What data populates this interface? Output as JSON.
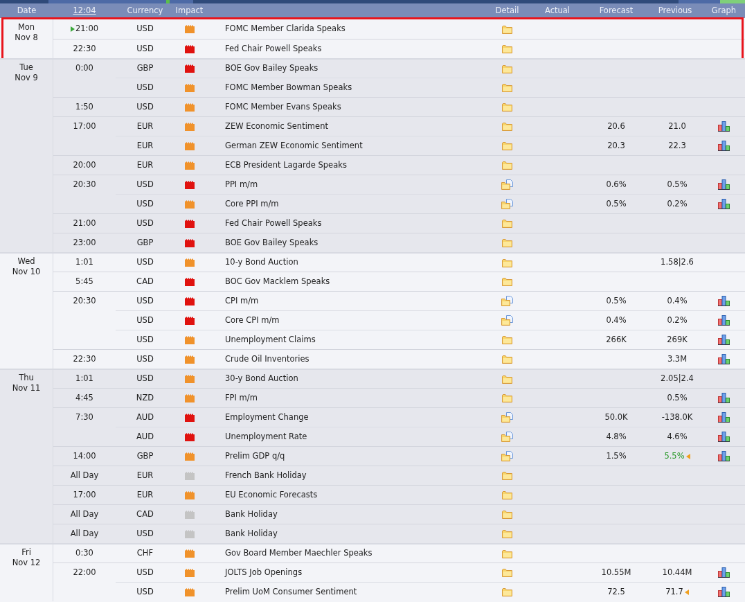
{
  "header": {
    "columns": [
      {
        "label": "Date",
        "link": false
      },
      {
        "label": "12:04",
        "link": true
      },
      {
        "label": "Currency",
        "link": false
      },
      {
        "label": "Impact",
        "link": false
      },
      {
        "label": "Detail",
        "link": false
      },
      {
        "label": "Actual",
        "link": false
      },
      {
        "label": "Forecast",
        "link": false
      },
      {
        "label": "Previous",
        "link": false
      },
      {
        "label": "Graph",
        "link": false
      }
    ]
  },
  "days": [
    {
      "weekday": "Mon",
      "date": "Nov 8",
      "highlighted": true,
      "slots": [
        {
          "time": "21:00",
          "upcoming": true,
          "events": [
            {
              "currency": "USD",
              "impact": {
                "kind": "medium"
              },
              "title": "FOMC Member Clarida Speaks",
              "detail": {
                "kind": "folder"
              },
              "graph": false
            }
          ]
        },
        {
          "time": "22:30",
          "upcoming": false,
          "events": [
            {
              "currency": "USD",
              "impact": {
                "kind": "high"
              },
              "title": "Fed Chair Powell Speaks",
              "detail": {
                "kind": "folder"
              },
              "graph": false
            }
          ]
        }
      ]
    },
    {
      "weekday": "Tue",
      "date": "Nov 9",
      "highlighted": false,
      "slots": [
        {
          "time": "0:00",
          "upcoming": false,
          "events": [
            {
              "currency": "GBP",
              "impact": {
                "kind": "high"
              },
              "title": "BOE Gov Bailey Speaks",
              "detail": {
                "kind": "folder"
              },
              "graph": false
            },
            {
              "currency": "USD",
              "impact": {
                "kind": "medium"
              },
              "title": "FOMC Member Bowman Speaks",
              "detail": {
                "kind": "folder"
              },
              "graph": false
            }
          ]
        },
        {
          "time": "1:50",
          "upcoming": false,
          "events": [
            {
              "currency": "USD",
              "impact": {
                "kind": "medium"
              },
              "title": "FOMC Member Evans Speaks",
              "detail": {
                "kind": "folder"
              },
              "graph": false
            }
          ]
        },
        {
          "time": "17:00",
          "upcoming": false,
          "events": [
            {
              "currency": "EUR",
              "impact": {
                "kind": "medium"
              },
              "title": "ZEW Economic Sentiment",
              "detail": {
                "kind": "folder"
              },
              "forecast": "20.6",
              "previous": "21.0",
              "graph": true
            },
            {
              "currency": "EUR",
              "impact": {
                "kind": "medium"
              },
              "title": "German ZEW Economic Sentiment",
              "detail": {
                "kind": "folder"
              },
              "forecast": "20.3",
              "previous": "22.3",
              "graph": true
            }
          ]
        },
        {
          "time": "20:00",
          "upcoming": false,
          "events": [
            {
              "currency": "EUR",
              "impact": {
                "kind": "medium"
              },
              "title": "ECB President Lagarde Speaks",
              "detail": {
                "kind": "folder"
              },
              "graph": false
            }
          ]
        },
        {
          "time": "20:30",
          "upcoming": false,
          "events": [
            {
              "currency": "USD",
              "impact": {
                "kind": "high"
              },
              "title": "PPI m/m",
              "detail": {
                "kind": "folder-doc"
              },
              "forecast": "0.6%",
              "previous": "0.5%",
              "graph": true
            },
            {
              "currency": "USD",
              "impact": {
                "kind": "medium"
              },
              "title": "Core PPI m/m",
              "detail": {
                "kind": "folder-doc"
              },
              "forecast": "0.5%",
              "previous": "0.2%",
              "graph": true
            }
          ]
        },
        {
          "time": "21:00",
          "upcoming": false,
          "events": [
            {
              "currency": "USD",
              "impact": {
                "kind": "high"
              },
              "title": "Fed Chair Powell Speaks",
              "detail": {
                "kind": "folder"
              },
              "graph": false
            }
          ]
        },
        {
          "time": "23:00",
          "upcoming": false,
          "events": [
            {
              "currency": "GBP",
              "impact": {
                "kind": "high"
              },
              "title": "BOE Gov Bailey Speaks",
              "detail": {
                "kind": "folder"
              },
              "graph": false
            }
          ]
        }
      ]
    },
    {
      "weekday": "Wed",
      "date": "Nov 10",
      "highlighted": false,
      "slots": [
        {
          "time": "1:01",
          "upcoming": false,
          "events": [
            {
              "currency": "USD",
              "impact": {
                "kind": "medium"
              },
              "title": "10-y Bond Auction",
              "detail": {
                "kind": "folder"
              },
              "previous": "1.58|2.6",
              "graph": false
            }
          ]
        },
        {
          "time": "5:45",
          "upcoming": false,
          "events": [
            {
              "currency": "CAD",
              "impact": {
                "kind": "high"
              },
              "title": "BOC Gov Macklem Speaks",
              "detail": {
                "kind": "folder"
              },
              "graph": false
            }
          ]
        },
        {
          "time": "20:30",
          "upcoming": false,
          "events": [
            {
              "currency": "USD",
              "impact": {
                "kind": "high"
              },
              "title": "CPI m/m",
              "detail": {
                "kind": "folder-doc"
              },
              "forecast": "0.5%",
              "previous": "0.4%",
              "graph": true
            },
            {
              "currency": "USD",
              "impact": {
                "kind": "high"
              },
              "title": "Core CPI m/m",
              "detail": {
                "kind": "folder-doc"
              },
              "forecast": "0.4%",
              "previous": "0.2%",
              "graph": true
            },
            {
              "currency": "USD",
              "impact": {
                "kind": "medium"
              },
              "title": "Unemployment Claims",
              "detail": {
                "kind": "folder"
              },
              "forecast": "266K",
              "previous": "269K",
              "graph": true
            }
          ]
        },
        {
          "time": "22:30",
          "upcoming": false,
          "events": [
            {
              "currency": "USD",
              "impact": {
                "kind": "medium"
              },
              "title": "Crude Oil Inventories",
              "detail": {
                "kind": "folder"
              },
              "previous": "3.3M",
              "graph": true
            }
          ]
        }
      ]
    },
    {
      "weekday": "Thu",
      "date": "Nov 11",
      "highlighted": false,
      "slots": [
        {
          "time": "1:01",
          "upcoming": false,
          "events": [
            {
              "currency": "USD",
              "impact": {
                "kind": "medium"
              },
              "title": "30-y Bond Auction",
              "detail": {
                "kind": "folder"
              },
              "previous": "2.05|2.4",
              "graph": false
            }
          ]
        },
        {
          "time": "4:45",
          "upcoming": false,
          "events": [
            {
              "currency": "NZD",
              "impact": {
                "kind": "medium"
              },
              "title": "FPI m/m",
              "detail": {
                "kind": "folder"
              },
              "previous": "0.5%",
              "graph": true
            }
          ]
        },
        {
          "time": "7:30",
          "upcoming": false,
          "events": [
            {
              "currency": "AUD",
              "impact": {
                "kind": "high"
              },
              "title": "Employment Change",
              "detail": {
                "kind": "folder-doc"
              },
              "forecast": "50.0K",
              "previous": "-138.0K",
              "graph": true
            },
            {
              "currency": "AUD",
              "impact": {
                "kind": "high"
              },
              "title": "Unemployment Rate",
              "detail": {
                "kind": "folder-doc"
              },
              "forecast": "4.8%",
              "previous": "4.6%",
              "graph": true
            }
          ]
        },
        {
          "time": "14:00",
          "upcoming": false,
          "events": [
            {
              "currency": "GBP",
              "impact": {
                "kind": "medium"
              },
              "title": "Prelim GDP q/q",
              "detail": {
                "kind": "folder-doc"
              },
              "forecast": "1.5%",
              "previous": "5.5%",
              "previous_better": true,
              "revised": true,
              "graph": true
            }
          ]
        },
        {
          "time": "All Day",
          "upcoming": false,
          "events": [
            {
              "currency": "EUR",
              "impact": {
                "kind": "holiday"
              },
              "title": "French Bank Holiday",
              "detail": {
                "kind": "folder"
              },
              "graph": false
            }
          ]
        },
        {
          "time": "17:00",
          "upcoming": false,
          "events": [
            {
              "currency": "EUR",
              "impact": {
                "kind": "medium"
              },
              "title": "EU Economic Forecasts",
              "detail": {
                "kind": "folder"
              },
              "graph": false
            }
          ]
        },
        {
          "time": "All Day",
          "upcoming": false,
          "events": [
            {
              "currency": "CAD",
              "impact": {
                "kind": "holiday"
              },
              "title": "Bank Holiday",
              "detail": {
                "kind": "folder"
              },
              "graph": false
            }
          ]
        },
        {
          "time": "All Day",
          "upcoming": false,
          "events": [
            {
              "currency": "USD",
              "impact": {
                "kind": "holiday"
              },
              "title": "Bank Holiday",
              "detail": {
                "kind": "folder"
              },
              "graph": false
            }
          ]
        }
      ]
    },
    {
      "weekday": "Fri",
      "date": "Nov 12",
      "highlighted": false,
      "slots": [
        {
          "time": "0:30",
          "upcoming": false,
          "events": [
            {
              "currency": "CHF",
              "impact": {
                "kind": "medium"
              },
              "title": "Gov Board Member Maechler Speaks",
              "detail": {
                "kind": "folder"
              },
              "graph": false
            }
          ]
        },
        {
          "time": "22:00",
          "upcoming": false,
          "events": [
            {
              "currency": "USD",
              "impact": {
                "kind": "medium"
              },
              "title": "JOLTS Job Openings",
              "detail": {
                "kind": "folder"
              },
              "forecast": "10.55M",
              "previous": "10.44M",
              "previous_better": false,
              "revised": false,
              "graph": true
            },
            {
              "currency": "USD",
              "impact": {
                "kind": "medium"
              },
              "title": "Prelim UoM Consumer Sentiment",
              "detail": {
                "kind": "folder"
              },
              "forecast": "72.5",
              "previous": "71.7",
              "previous_better": false,
              "revised": true,
              "graph": true
            }
          ]
        }
      ]
    }
  ]
}
